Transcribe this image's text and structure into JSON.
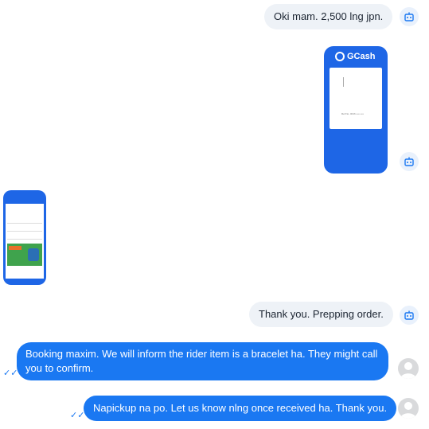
{
  "messages": [
    {
      "text": "Oki mam. 2,500 lng jpn."
    },
    {
      "gcash_label": "GCash",
      "receipt_text": "Ref No. 0016 •••• ••••"
    },
    {
      "type": "image"
    },
    {
      "text": "Thank you. Prepping order."
    },
    {
      "text": "Booking maxim. We will inform the rider item is a bracelet ha. They might call you to confirm."
    },
    {
      "text": "Napickup na po. Let us know nlng once received ha. Thank you."
    }
  ],
  "colors": {
    "outgoing": "#1a78f2",
    "incoming": "#eef2f7",
    "gcash": "#1e66e6"
  },
  "icons": {
    "bot": "bot-icon",
    "read": "check-icon"
  }
}
